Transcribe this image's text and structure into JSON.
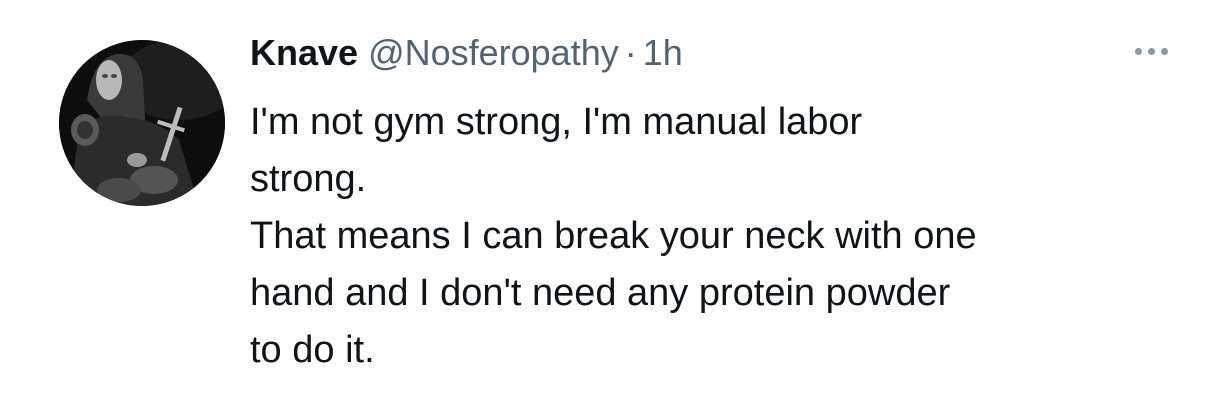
{
  "tweet": {
    "display_name": "Knave",
    "handle": "@Nosferopathy",
    "separator": "·",
    "timestamp": "1h",
    "more_icon": "more-horizontal-icon",
    "text_lines": [
      "I'm not gym strong, I'm manual labor",
      "strong.",
      "That means I can break your neck with one",
      "hand and I don't need any protein powder",
      "to do it."
    ]
  },
  "colors": {
    "name": "#0f1419",
    "secondary": "#536471",
    "more_dots": "#8b98a5",
    "background": "#ffffff"
  }
}
